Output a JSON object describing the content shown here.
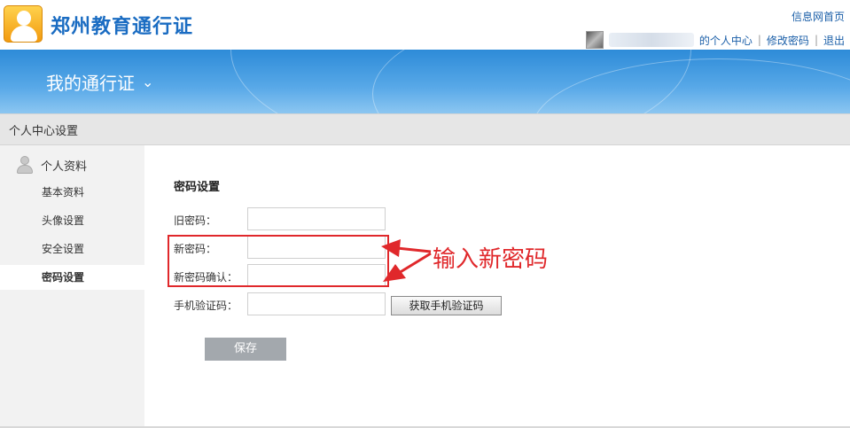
{
  "header": {
    "site_title": "郑州教育通行证",
    "home_link": "信息网首页",
    "user_center": "的个人中心",
    "change_password": "修改密码",
    "logout": "退出",
    "separator": "|"
  },
  "banner": {
    "title": "我的通行证",
    "dropdown_icon": "chevron-down-icon"
  },
  "section": {
    "title": "个人中心设置"
  },
  "sidebar": {
    "group_label": "个人资料",
    "items": [
      {
        "label": "基本资料"
      },
      {
        "label": "头像设置"
      },
      {
        "label": "安全设置"
      },
      {
        "label": "密码设置",
        "active": true
      }
    ]
  },
  "form": {
    "title": "密码设置",
    "old_password_label": "旧密码：",
    "new_password_label": "新密码：",
    "confirm_password_label": "新密码确认：",
    "sms_code_label": "手机验证码：",
    "get_sms_button": "获取手机验证码",
    "save_button": "保存"
  },
  "annotation": {
    "text": "输入新密码",
    "color": "#e0282b"
  },
  "colors": {
    "brand": "#1a6cc2",
    "banner": "#2d8bd8"
  }
}
